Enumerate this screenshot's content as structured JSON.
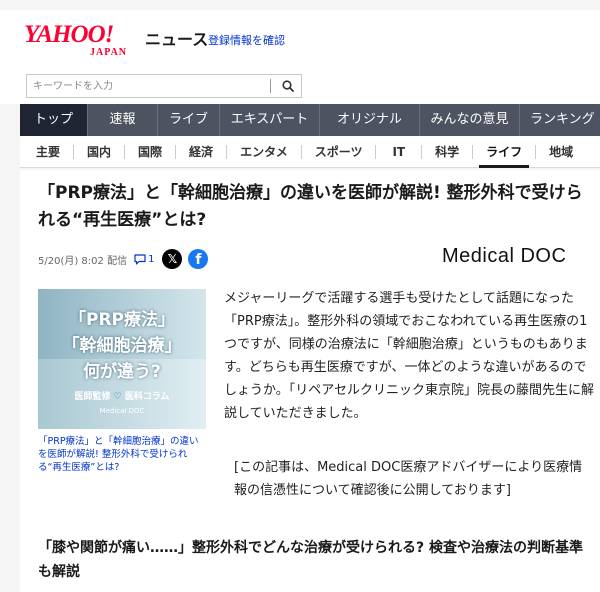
{
  "header": {
    "logo_main": "YAHOO!",
    "logo_sub": "JAPAN",
    "site_label": "ニュース",
    "register_link": "登録情報を確認"
  },
  "search": {
    "placeholder": "キーワードを入力",
    "button_icon": "search-icon"
  },
  "nav": {
    "items": [
      {
        "label": "トップ",
        "active": true
      },
      {
        "label": "速報",
        "active": false
      },
      {
        "label": "ライブ",
        "active": false
      },
      {
        "label": "エキスパート",
        "active": false
      },
      {
        "label": "オリジナル",
        "active": false
      },
      {
        "label": "みんなの意見",
        "active": false
      },
      {
        "label": "ランキング",
        "active": false
      }
    ]
  },
  "subnav": {
    "items": [
      {
        "label": "主要",
        "active": false
      },
      {
        "label": "国内",
        "active": false
      },
      {
        "label": "国際",
        "active": false
      },
      {
        "label": "経済",
        "active": false
      },
      {
        "label": "エンタメ",
        "active": false
      },
      {
        "label": "スポーツ",
        "active": false
      },
      {
        "label": "IT",
        "active": false
      },
      {
        "label": "科学",
        "active": false
      },
      {
        "label": "ライフ",
        "active": true
      },
      {
        "label": "地域",
        "active": false
      }
    ]
  },
  "article": {
    "headline": "「PRP療法」と「幹細胞治療」の違いを医師が解説! 整形外科で受けられる“再生医療”とは?",
    "date": "5/20(月) 8:02 配信",
    "comment_count": "1",
    "share_icons": [
      "x-icon",
      "facebook-icon"
    ],
    "publisher": "Medical DOC",
    "image": {
      "line1": "「PRP療法」",
      "line2": "「幹細胞治療」",
      "line3": "何が違う?",
      "tag_left": "医師監修",
      "tag_right": "医科コラム",
      "brand": "Medical DOC"
    },
    "image_caption": "「PRP療法」と「幹細胞治療」の違いを医師が解説! 整形外科で受けられる“再生医療”とは?",
    "body": "メジャーリーグで活躍する選手も受けたとして話題になった「PRP療法」。整形外科の領域でおこなわれている再生医療の1つですが、同様の治療法に「幹細胞治療」というものもあります。どちらも再生医療ですが、一体どのような違いがあるのでしょうか。「リペアセルクリニック東京院」院長の藤間先生に解説していただきました。",
    "note": "[この記事は、Medical DOC医療アドバイザーにより医療情報の信憑性について確認後に公開しております]",
    "subhead": "「膝や関節が痛い……」整形外科でどんな治療が受けられる? 検査や治療法の判断基準も解説"
  },
  "colors": {
    "brand_red": "#ff0033",
    "nav_bg": "#4d5361",
    "nav_active": "#1f2533",
    "link_blue": "#0033cc"
  }
}
